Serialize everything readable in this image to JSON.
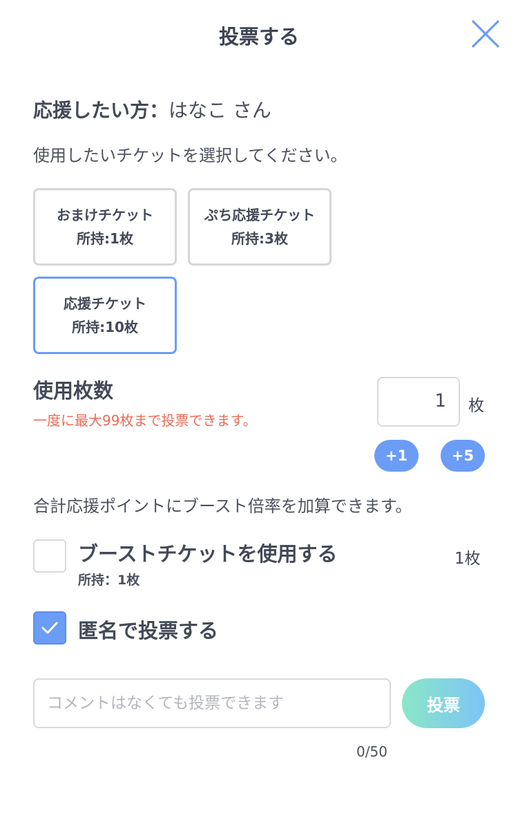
{
  "header": {
    "title": "投票する"
  },
  "recipient": {
    "label": "応援したい方：",
    "name": "はなこ さん"
  },
  "instruction": "使用したいチケットを選択してください。",
  "tickets": [
    {
      "name": "おまけチケット",
      "held": "所持:1枚",
      "selected": false
    },
    {
      "name": "ぷち応援チケット",
      "held": "所持:3枚",
      "selected": false
    },
    {
      "name": "応援チケット",
      "held": "所持:10枚",
      "selected": true
    }
  ],
  "usage": {
    "title": "使用枚数",
    "note": "一度に最大99枚まで投票できます。",
    "value": "1",
    "unit": "枚",
    "plus1": "+1",
    "plus5": "+5"
  },
  "boost": {
    "description": "合計応援ポイントにブースト倍率を加算できます。",
    "label": "ブーストチケットを使用する",
    "held": "所持：1枚",
    "quantity": "1枚",
    "checked": false
  },
  "anonymous": {
    "label": "匿名で投票する",
    "checked": true
  },
  "comment": {
    "placeholder": "コメントはなくても投票できます",
    "value": "",
    "counter": "0/50"
  },
  "vote_button": "投票",
  "colors": {
    "accent": "#6b9cf6",
    "warning": "#ee6b55",
    "border": "#d9d9d9",
    "text": "#444957"
  },
  "icons": {
    "close": "close-icon",
    "check": "check-icon"
  }
}
